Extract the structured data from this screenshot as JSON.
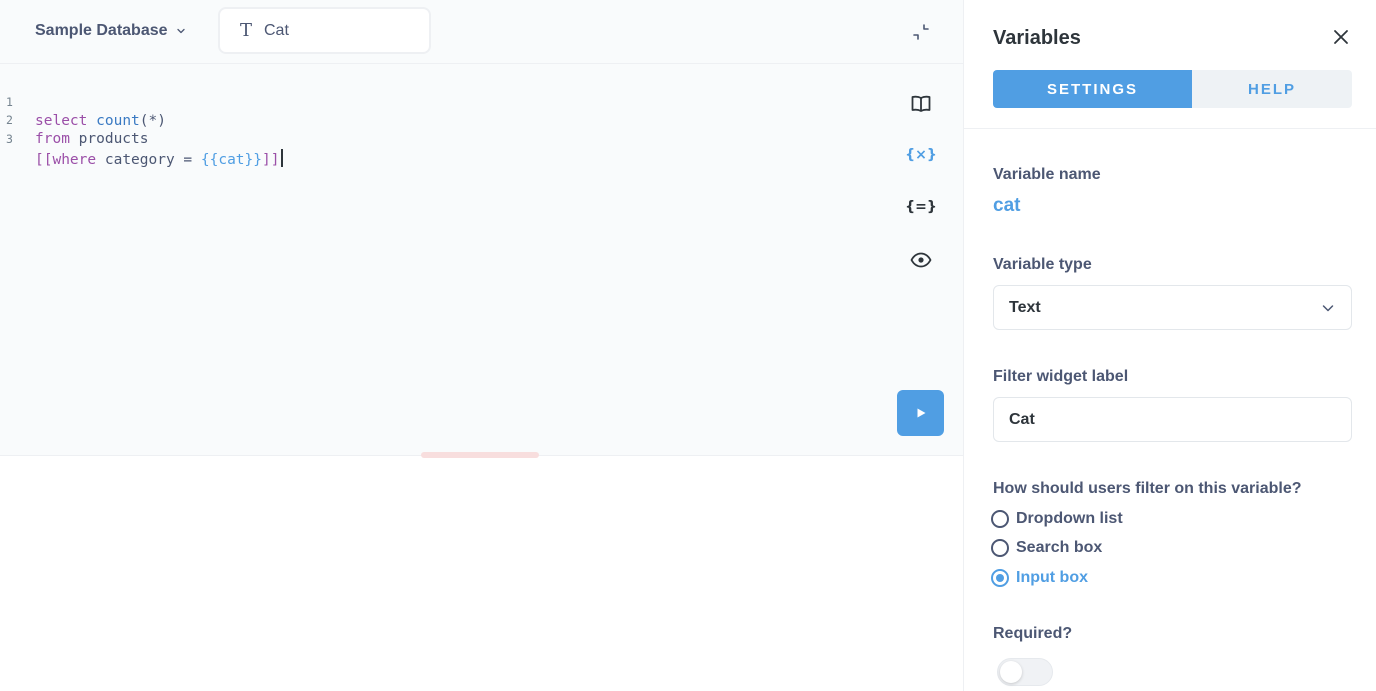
{
  "editor": {
    "database_label": "Sample Database",
    "variable_widget_icon": "T",
    "variable_widget_label": "Cat",
    "lines": [
      {
        "num": "1",
        "tokens": [
          {
            "text": "select",
            "cls": "kw"
          },
          {
            "text": " ",
            "cls": "pl"
          },
          {
            "text": "count",
            "cls": "fn"
          },
          {
            "text": "(*)",
            "cls": "pl"
          }
        ]
      },
      {
        "num": "2",
        "tokens": [
          {
            "text": "from",
            "cls": "kw"
          },
          {
            "text": " products",
            "cls": "pl"
          }
        ]
      },
      {
        "num": "3",
        "tokens": [
          {
            "text": "[[",
            "cls": "br"
          },
          {
            "text": "where",
            "cls": "kw"
          },
          {
            "text": " category = ",
            "cls": "pl"
          },
          {
            "text": "{{cat}}",
            "cls": "tag"
          },
          {
            "text": "]]",
            "cls": "br"
          }
        ]
      }
    ],
    "tools": {
      "variables_glyph": "{×}",
      "snippets_glyph": "{=}"
    }
  },
  "sidebar": {
    "title": "Variables",
    "tabs": [
      {
        "label": "SETTINGS",
        "active": true
      },
      {
        "label": "HELP",
        "active": false
      }
    ],
    "variable_name_label": "Variable name",
    "variable_name_value": "cat",
    "variable_type_label": "Variable type",
    "variable_type_value": "Text",
    "filter_widget_label": "Filter widget label",
    "filter_widget_value": "Cat",
    "filter_question": "How should users filter on this variable?",
    "filter_options": [
      {
        "label": "Dropdown list",
        "checked": false
      },
      {
        "label": "Search box",
        "checked": false
      },
      {
        "label": "Input box",
        "checked": true
      }
    ],
    "required_label": "Required?",
    "required_value": false
  },
  "colors": {
    "brand": "#509ee3",
    "text_dark": "#2e353b",
    "text_medium": "#4c5773",
    "sql_keyword": "#9b4fa8",
    "editor_bg": "#f9fbfc"
  },
  "icons": {
    "db_chevron": "chevron-down-icon",
    "collapse": "collapse-icon",
    "reference": "book-icon",
    "variables": "variables-icon",
    "snippets": "snippets-icon",
    "preview": "eye-icon",
    "run": "play-icon",
    "close": "close-icon",
    "select_chevron": "chevron-down-icon"
  }
}
